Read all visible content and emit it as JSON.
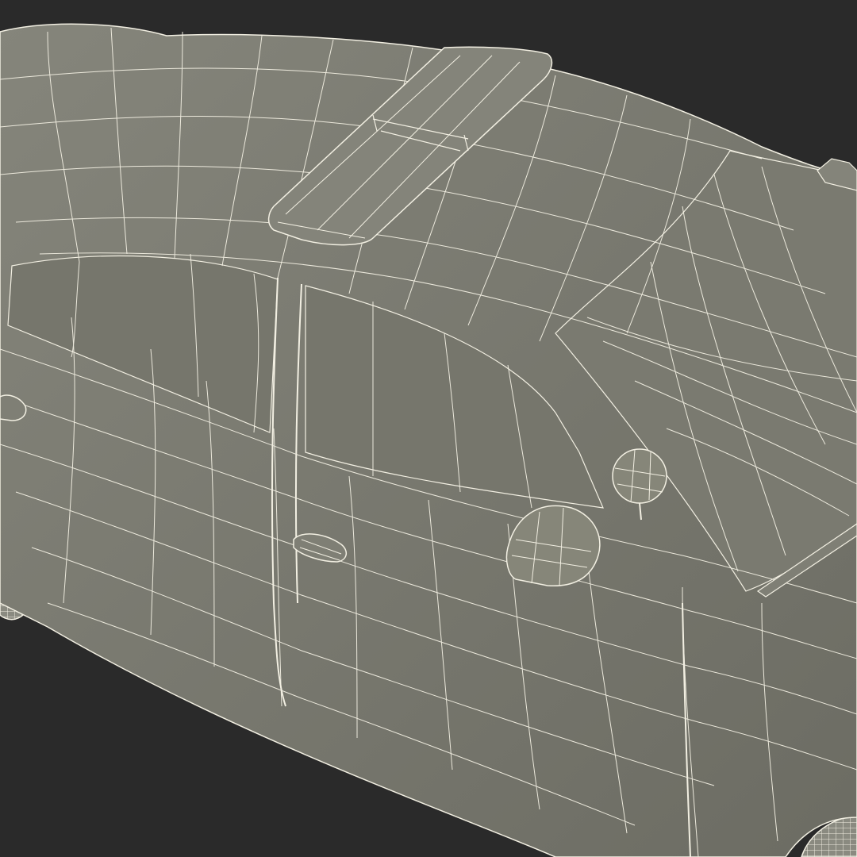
{
  "scene": {
    "subject": "wireframe-police-car",
    "colors": {
      "background": "#2a2a2a",
      "body_fill": "#7c7c72",
      "body_shade": "#6e6e65",
      "glass_fill": "#76766c",
      "wire": "#f2efe2",
      "tire": "#8a8a80"
    }
  }
}
